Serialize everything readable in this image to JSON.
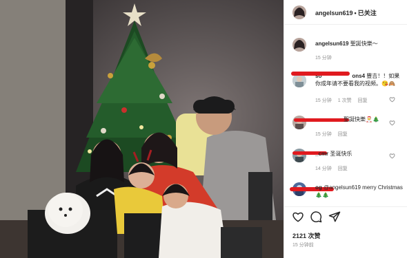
{
  "post": {
    "username": "angelsun619",
    "follow_dot": "•",
    "follow_label": "已关注"
  },
  "caption": {
    "username": "angelsun619",
    "text": "聖誕快樂～",
    "time": "15 分钟"
  },
  "comments": [
    {
      "username": "so",
      "username_tail": "ons4",
      "text": "豐吉！！如果你成年请不要看我的视频。😘🙈",
      "time": "15 分钟",
      "likes": "1 次赞",
      "reply": "回复"
    },
    {
      "username": "",
      "username_tail": "",
      "text": "聖誕快樂🎅🎄",
      "time": "15 分钟",
      "likes": "",
      "reply": "回复"
    },
    {
      "username": "",
      "username_tail": "_cmr",
      "text": "圣诞快乐",
      "time": "14 分钟",
      "likes": "",
      "reply": "回复"
    },
    {
      "username": "",
      "username_tail": "og",
      "text": "@angelsun619 merry Christmas🎄🎄",
      "time": "",
      "likes": "",
      "reply": ""
    }
  ],
  "footer": {
    "likes": "2121 次赞",
    "time": "15 分钟前"
  },
  "icons": [
    "heart-icon",
    "comment-icon",
    "share-icon"
  ],
  "colors": {
    "redaction": "#e01a1f",
    "text": "#262626",
    "muted": "#8e8e8e"
  }
}
